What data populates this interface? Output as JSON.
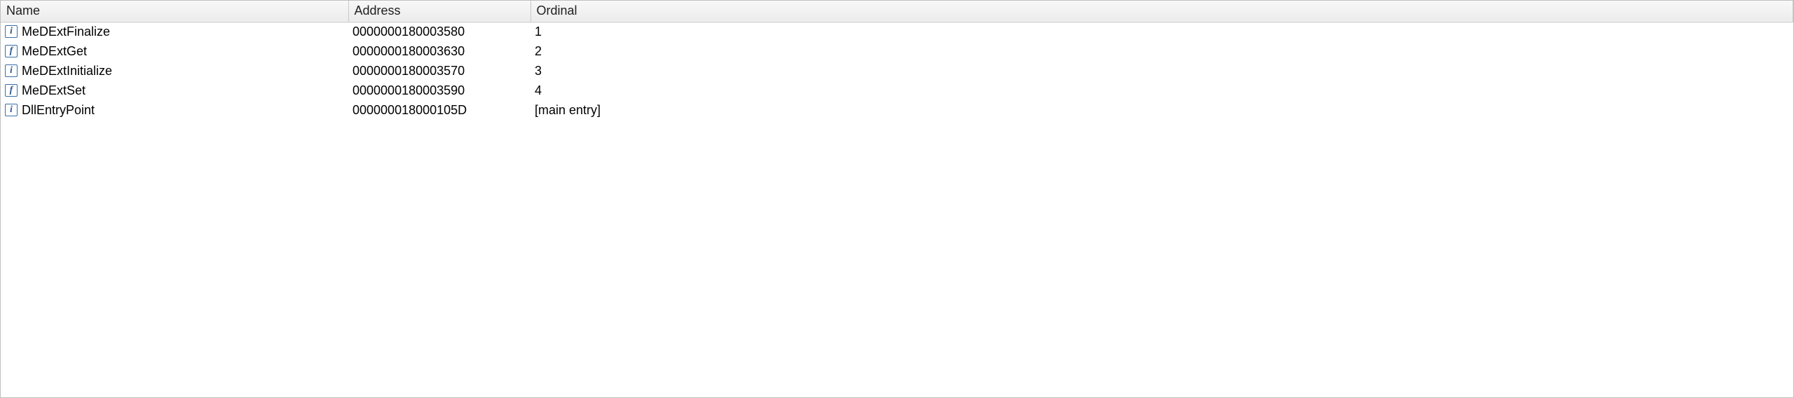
{
  "columns": {
    "name": "Name",
    "address": "Address",
    "ordinal": "Ordinal"
  },
  "rows": [
    {
      "icon": "i",
      "iconName": "info-icon",
      "name": "MeDExtFinalize",
      "address": "0000000180003580",
      "ordinal": "1"
    },
    {
      "icon": "f",
      "iconName": "function-icon",
      "name": "MeDExtGet",
      "address": "0000000180003630",
      "ordinal": "2"
    },
    {
      "icon": "i",
      "iconName": "info-icon",
      "name": "MeDExtInitialize",
      "address": "0000000180003570",
      "ordinal": "3"
    },
    {
      "icon": "f",
      "iconName": "function-icon",
      "name": "MeDExtSet",
      "address": "0000000180003590",
      "ordinal": "4"
    },
    {
      "icon": "i",
      "iconName": "info-icon",
      "name": "DllEntryPoint",
      "address": "000000018000105D",
      "ordinal": "[main entry]"
    }
  ]
}
